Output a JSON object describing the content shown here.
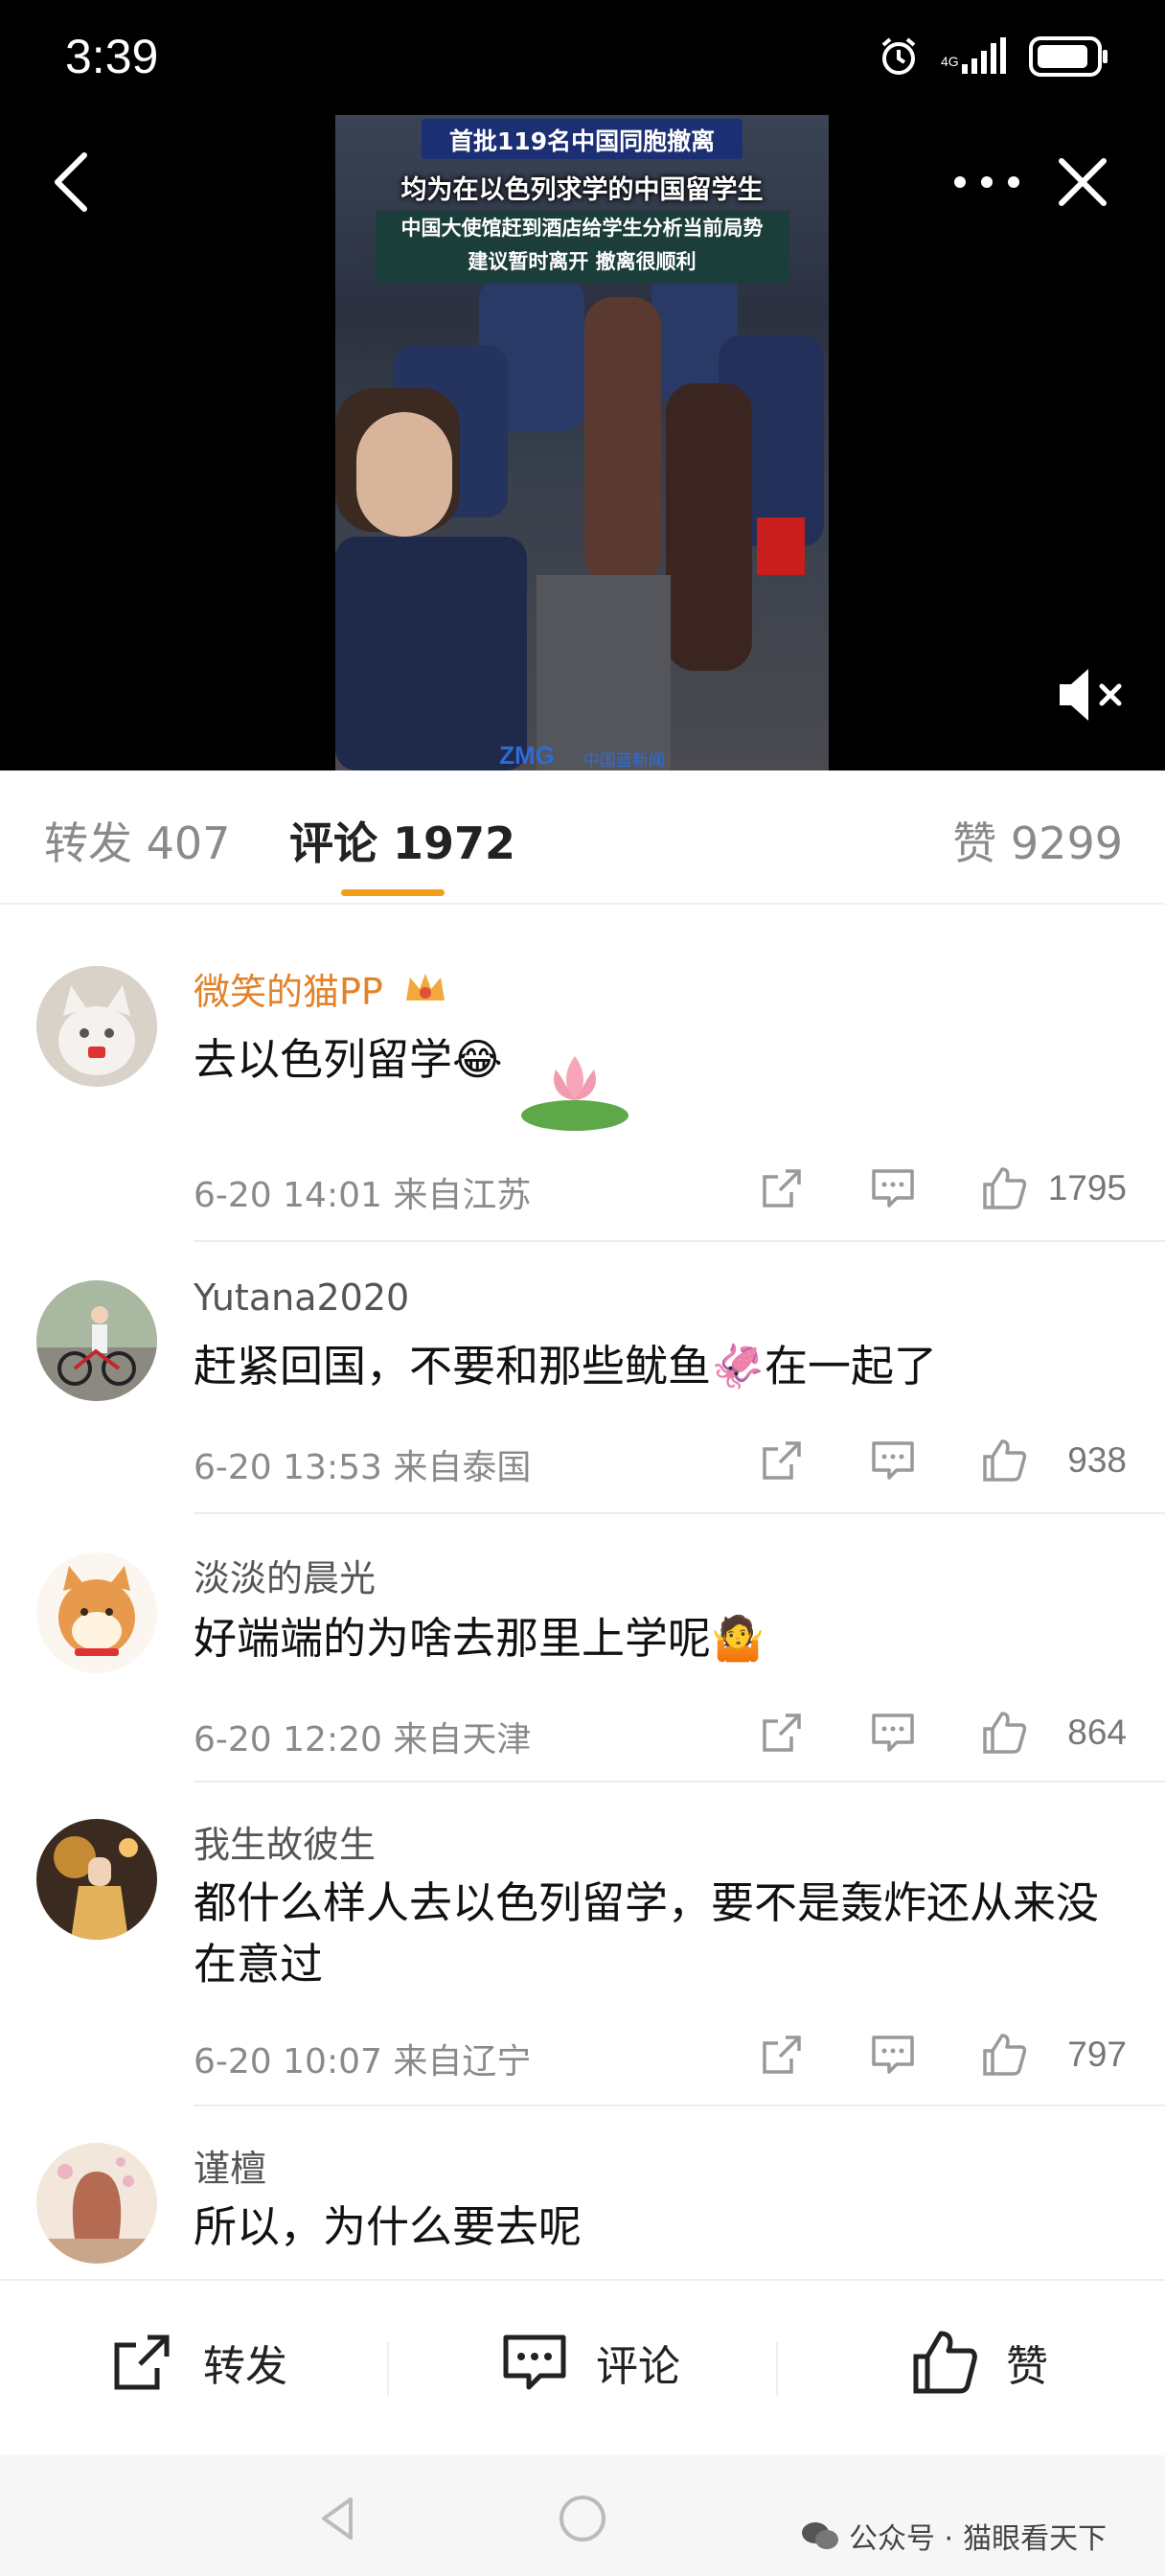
{
  "status_bar": {
    "time": "3:39"
  },
  "video": {
    "caption_title": "首批119名中国同胞撤离",
    "caption_subtitle": "均为在以色列求学的中国留学生",
    "caption_line3": "中国大使馆赶到酒店给学生分析当前局势",
    "caption_line4": "建议暂时离开 撤离很顺利",
    "logo_left": "ZMG",
    "logo_right": "中国蓝新闻"
  },
  "tabs": {
    "repost": "转发 407",
    "comments": "评论 1972",
    "likes": "赞 9299"
  },
  "comments": [
    {
      "name": "微笑的猫PP",
      "text": "去以色列留学😂",
      "meta": "6-20 14:01 来自江苏",
      "likes": "1795"
    },
    {
      "name": "Yutana2020",
      "text": "赶紧回国，不要和那些鱿鱼🦑在一起了",
      "meta": "6-20 13:53 来自泰国",
      "likes": "938"
    },
    {
      "name": "淡淡的晨光",
      "text": "好端端的为啥去那里上学呢🤷",
      "meta": "6-20 12:20 来自天津",
      "likes": "864"
    },
    {
      "name": "我生故彼生",
      "text": "都什么样人去以色列留学，要不是轰炸还从来没在意过",
      "meta": "6-20 10:07 来自辽宁",
      "likes": "797"
    },
    {
      "name": "谨檀",
      "text": "所以，为什么要去呢"
    }
  ],
  "action_bar": {
    "repost_label": "转发",
    "comment_label": "评论",
    "like_label": "赞"
  },
  "watermark": {
    "prefix": "公众号 · ",
    "name": "猫眼看天下"
  },
  "colors": {
    "accent": "#f29e1a",
    "vip_name": "#e2822a",
    "muted": "#8a8a8a"
  }
}
